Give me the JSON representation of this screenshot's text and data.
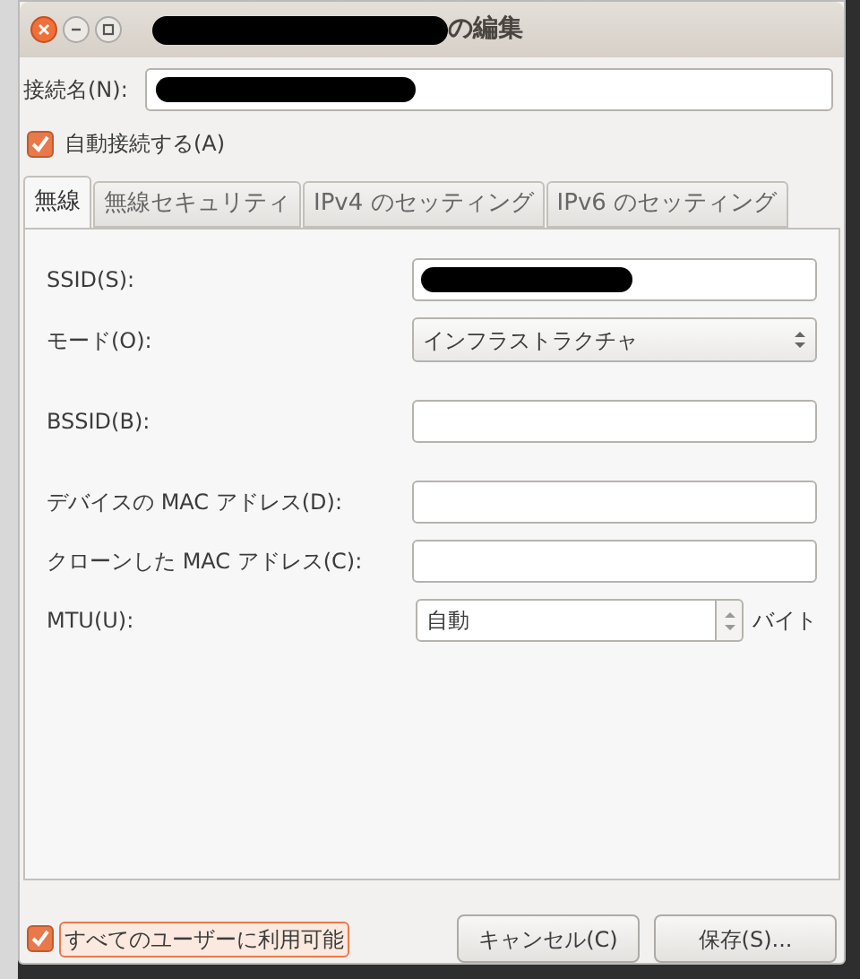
{
  "window": {
    "title": "の編集",
    "title_redacted": true
  },
  "connection_name": {
    "label": "接続名(N):",
    "redacted": true
  },
  "auto_connect": {
    "label": "自動接続する(A)",
    "checked": true
  },
  "tabs": [
    {
      "label": "無線",
      "selected": true
    },
    {
      "label": "無線セキュリティ",
      "selected": false
    },
    {
      "label": "IPv4 のセッティング",
      "selected": false
    },
    {
      "label": "IPv6 のセッティング",
      "selected": false
    }
  ],
  "fields": [
    {
      "kind": "text",
      "label": "SSID(S):",
      "redacted": true
    },
    {
      "kind": "combo",
      "label": "モード(O):",
      "value": "インフラストラクチャ"
    },
    {
      "kind": "text",
      "label": "BSSID(B):",
      "redacted": false
    },
    {
      "kind": "text",
      "label": "デバイスの MAC アドレス(D):",
      "redacted": false
    },
    {
      "kind": "text",
      "label": "クローンした MAC アドレス(C):",
      "redacted": false
    },
    {
      "kind": "spin",
      "label": "MTU(U):",
      "value": "自動",
      "unit": "バイト"
    }
  ],
  "all_users": {
    "label": "すべてのユーザーに利用可能",
    "checked": true,
    "focused": true
  },
  "buttons": [
    "キャンセル(C)",
    "保存(S)..."
  ]
}
